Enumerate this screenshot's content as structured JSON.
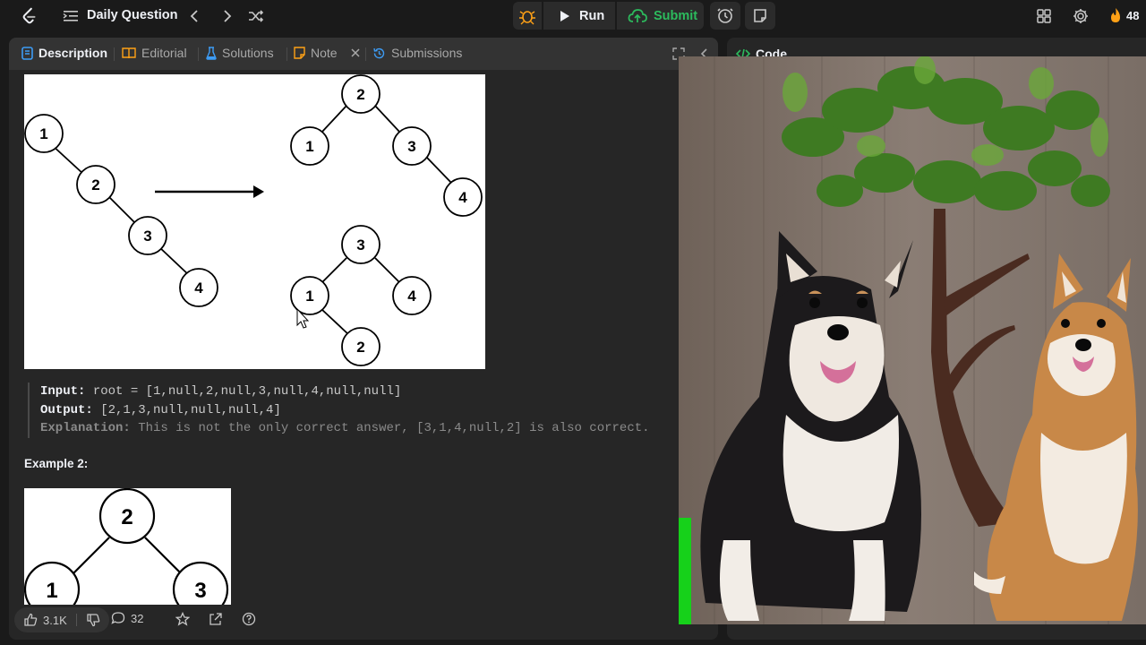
{
  "topbar": {
    "title": "Daily Question",
    "run_label": "Run",
    "submit_label": "Submit",
    "streak": "48"
  },
  "tabs": [
    {
      "label": "Description"
    },
    {
      "label": "Editorial"
    },
    {
      "label": "Solutions"
    },
    {
      "label": "Note"
    },
    {
      "label": "Submissions"
    }
  ],
  "right_panel": {
    "code_tab": "Code"
  },
  "example1": {
    "before_tree": [
      "1",
      "2",
      "3",
      "4"
    ],
    "after_tree_a": [
      "2",
      "1",
      "3",
      "4"
    ],
    "after_tree_b": [
      "3",
      "1",
      "4",
      "2"
    ],
    "input_key": "Input:",
    "input_val": " root = [1,null,2,null,3,null,4,null,null]",
    "output_key": "Output:",
    "output_val": " [2,1,3,null,null,null,4]",
    "explanation_key": "Explanation:",
    "explanation_val": " This is not the only correct answer, [3,1,4,null,2] is also correct."
  },
  "example2": {
    "title": "Example 2:",
    "tree": [
      "2",
      "1",
      "3"
    ]
  },
  "bottombar": {
    "likes": "3.1K",
    "comments": "32"
  },
  "colors": {
    "accent_green": "#2cbb5d",
    "streak_orange": "#ffa116",
    "panel_bg": "#262626",
    "tabs_bg": "#333333"
  }
}
